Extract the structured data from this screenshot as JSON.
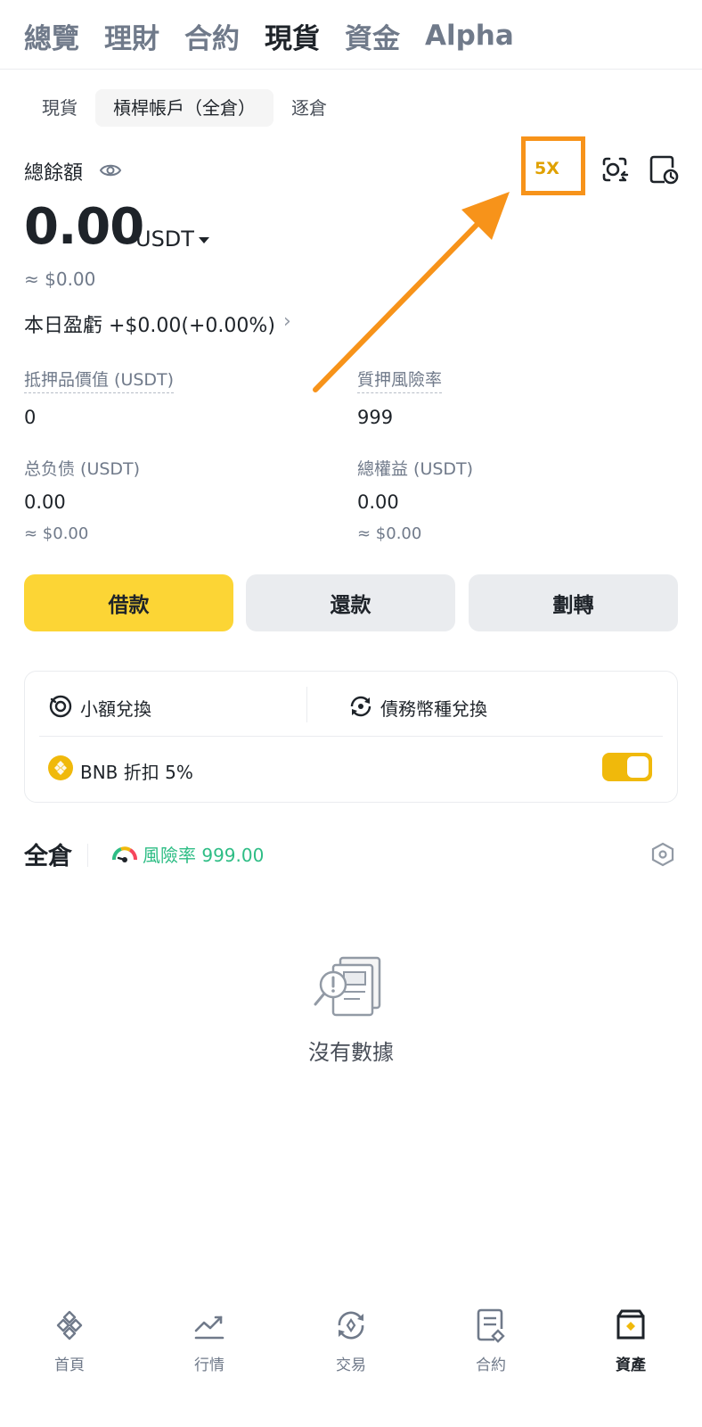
{
  "top_tabs": [
    "總覽",
    "理財",
    "合約",
    "現貨",
    "資金",
    "Alpha"
  ],
  "sub_tabs": [
    "現貨",
    "槓桿帳戶（全倉）",
    "逐倉"
  ],
  "summary": {
    "total_label": "總餘額",
    "leverage": "5X",
    "balance": "0.00",
    "currency": "USDT",
    "approx": "≈ $0.00",
    "pnl": "本日盈虧 +$0.00(+0.00%)",
    "pnl_chevron": "›"
  },
  "metrics": {
    "collateral": {
      "label": "抵押品價值 (USDT)",
      "value": "0"
    },
    "risk_ratio": {
      "label": "質押風險率",
      "value": "999"
    },
    "total_debt": {
      "label": "总负债 (USDT)",
      "value": "0.00",
      "approx": "≈ $0.00"
    },
    "total_equity": {
      "label": "總權益 (USDT)",
      "value": "0.00",
      "approx": "≈ $0.00"
    }
  },
  "actions": {
    "borrow": "借款",
    "repay": "還款",
    "transfer": "劃轉"
  },
  "card": {
    "small_convert": "小額兌換",
    "debt_convert": "債務幣種兌換",
    "bnb_discount": "BNB 折扣 5%",
    "bnb_toggle_on": true
  },
  "cross": {
    "title": "全倉",
    "risk_text": "風險率 999.00",
    "empty_text": "沒有數據"
  },
  "bottom_nav": [
    "首頁",
    "行情",
    "交易",
    "合約",
    "資產"
  ],
  "colors": {
    "brand_yellow": "#fcd535",
    "toggle": "#f0b90b",
    "leverage_text": "#e0a100",
    "annotation_orange": "#f7931a",
    "risk_green": "#2ebd85"
  }
}
